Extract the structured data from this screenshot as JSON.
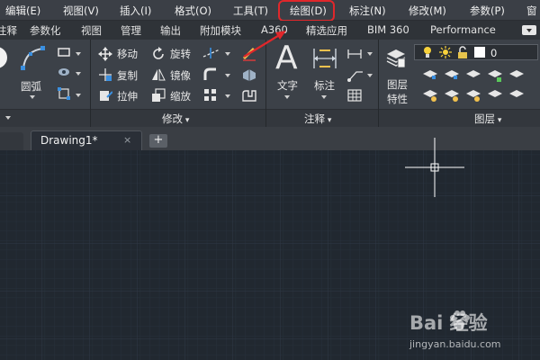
{
  "menu": {
    "items": [
      "编辑(E)",
      "视图(V)",
      "插入(I)",
      "格式(O)",
      "工具(T)",
      "绘图(D)",
      "标注(N)",
      "修改(M)",
      "参数(P)",
      "窗"
    ],
    "highlighted": "绘图(D)"
  },
  "ribbon_tabs": [
    "注释",
    "参数化",
    "视图",
    "管理",
    "输出",
    "附加模块",
    "A360",
    "精选应用",
    "BIM 360",
    "Performance"
  ],
  "panels": {
    "draw": {
      "arc_label": "圆弧"
    },
    "modify": {
      "title": "修改",
      "tools": {
        "move": "移动",
        "rotate": "旋转",
        "copy": "复制",
        "mirror": "镜像",
        "stretch": "拉伸",
        "scale": "缩放"
      }
    },
    "annotation": {
      "title": "注释",
      "text_glyph": "A",
      "text_label": "文字",
      "dimension_label": "标注"
    },
    "layers": {
      "title": "图层",
      "properties_label": [
        "图层",
        "特性"
      ],
      "current_layer": "0"
    }
  },
  "document_tab": {
    "name": "Drawing1*",
    "close": "×",
    "new_tab": "+"
  },
  "watermark": {
    "brand": "Bai 经验",
    "url": "jingyan.baidu.com"
  },
  "colors": {
    "highlight": "#e0272b",
    "canvas": "#212830",
    "grid": "#2c3541",
    "accent": "#e0272b"
  },
  "icons": [
    "move-icon",
    "rotate-icon",
    "copy-icon",
    "mirror-icon",
    "stretch-icon",
    "scale-icon",
    "arc-icon",
    "lightbulb-icon",
    "sun-icon",
    "lock-icon",
    "paw-icon"
  ]
}
